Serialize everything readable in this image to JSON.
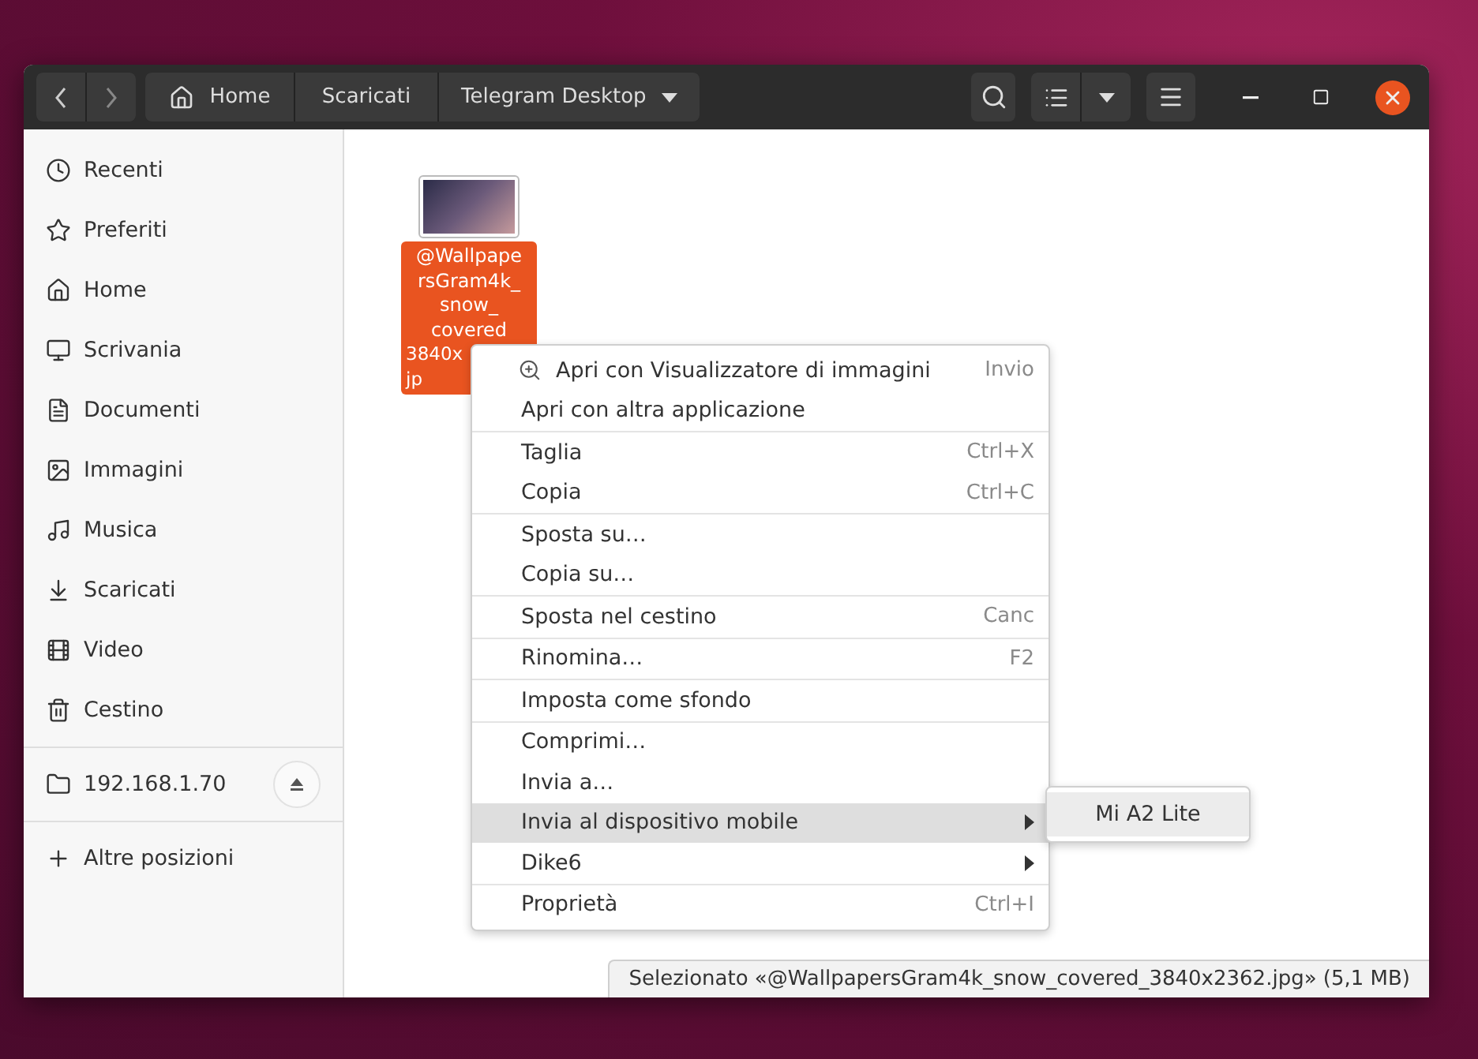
{
  "header": {
    "path": [
      {
        "label": "Home",
        "kind": "home"
      },
      {
        "label": "Scaricati",
        "kind": "plain"
      },
      {
        "label": "Telegram Desktop",
        "kind": "dropdown"
      }
    ]
  },
  "sidebar": {
    "places": [
      {
        "label": "Recenti",
        "selected": false
      },
      {
        "label": "Preferiti",
        "selected": false
      },
      {
        "label": "Home",
        "selected": false
      },
      {
        "label": "Scrivania",
        "selected": false
      },
      {
        "label": "Documenti",
        "selected": false
      },
      {
        "label": "Immagini",
        "selected": false
      },
      {
        "label": "Musica",
        "selected": false
      },
      {
        "label": "Scaricati",
        "selected": false
      },
      {
        "label": "Video",
        "selected": false
      },
      {
        "label": "Cestino",
        "selected": false
      }
    ],
    "devices": [
      {
        "label": "192.168.1.70",
        "selected": false
      }
    ],
    "other": {
      "label": "Altre posizioni"
    }
  },
  "files": [
    {
      "name_lines": [
        "@Wallpape",
        "rsGram4k_",
        "snow_",
        "covered",
        "3840x",
        "jp"
      ],
      "selected": true
    }
  ],
  "context_menu": {
    "sections": [
      [
        {
          "label": "Apri con Visualizzatore di immagini",
          "shortcut": "Invio",
          "kind": "app",
          "selected": false
        },
        {
          "label": "Apri con altra applicazione",
          "kind": "action",
          "selected": false
        }
      ],
      [
        {
          "label": "Taglia",
          "shortcut": "Ctrl+X",
          "kind": "action",
          "selected": false
        },
        {
          "label": "Copia",
          "shortcut": "Ctrl+C",
          "kind": "action",
          "selected": false
        }
      ],
      [
        {
          "label": "Sposta su…",
          "kind": "action",
          "selected": false
        },
        {
          "label": "Copia su…",
          "kind": "action",
          "selected": false
        }
      ],
      [
        {
          "label": "Sposta nel cestino",
          "shortcut": "Canc",
          "kind": "action",
          "selected": false
        }
      ],
      [
        {
          "label": "Rinomina…",
          "shortcut": "F2",
          "kind": "action",
          "selected": false
        }
      ],
      [
        {
          "label": "Imposta come sfondo",
          "kind": "action",
          "selected": false
        }
      ],
      [
        {
          "label": "Comprimi…",
          "kind": "action",
          "selected": false
        },
        {
          "label": "Invia a…",
          "kind": "action",
          "selected": false
        },
        {
          "label": "Invia al dispositivo mobile",
          "kind": "submenu",
          "selected": true
        },
        {
          "label": "Dike6",
          "kind": "submenu",
          "selected": false
        }
      ],
      [
        {
          "label": "Proprietà",
          "shortcut": "Ctrl+I",
          "kind": "action",
          "selected": false
        }
      ]
    ],
    "submenu": [
      {
        "label": "Mi A2 Lite",
        "selected": false
      }
    ]
  },
  "status_bar": {
    "text": "Selezionato «@WallpapersGram4k_snow_covered_3840x2362.jpg» (5,1 MB)"
  }
}
